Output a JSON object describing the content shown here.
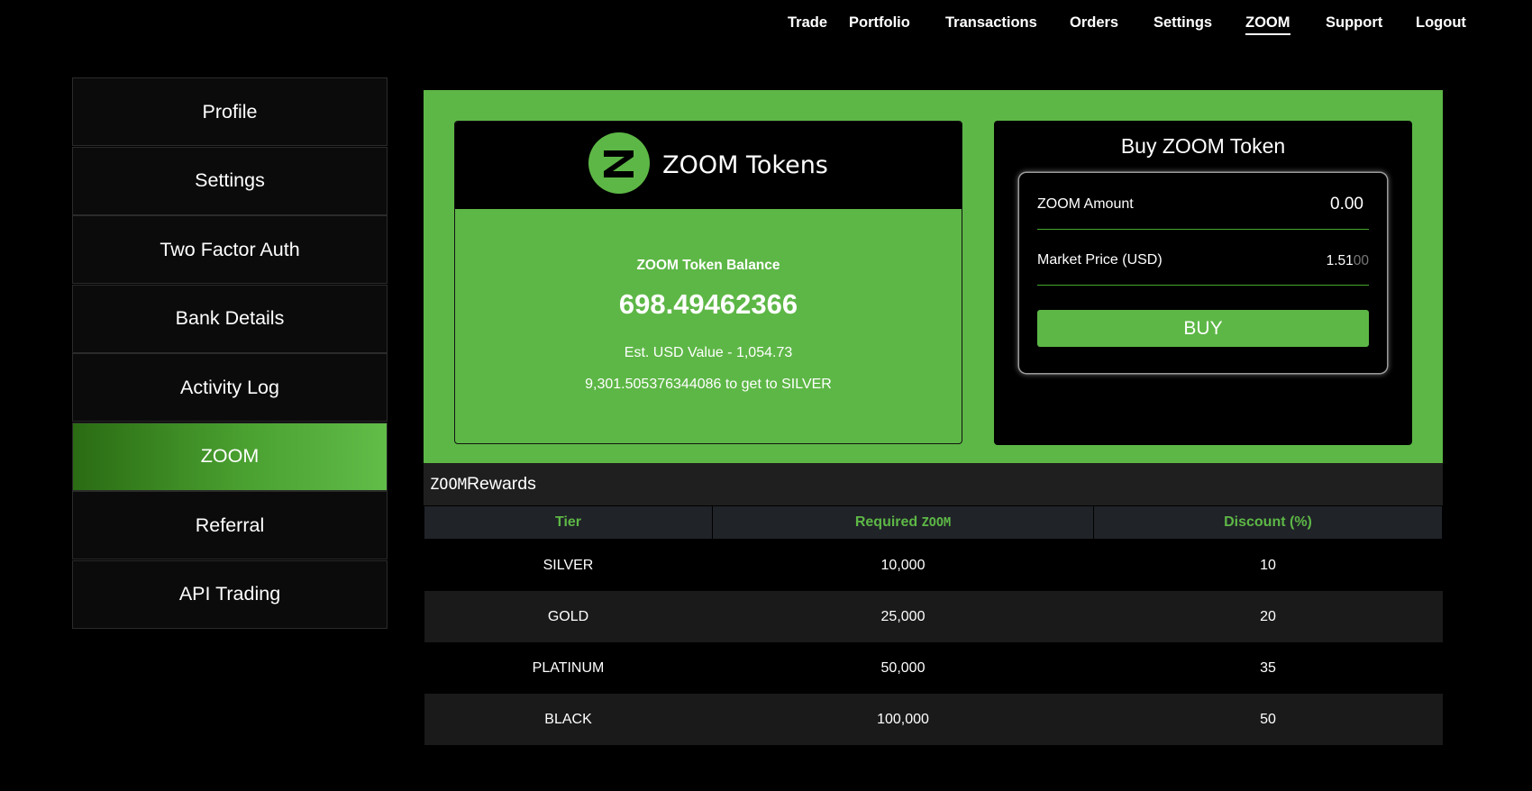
{
  "nav": {
    "items": [
      {
        "label": "Trade"
      },
      {
        "label": "Portfolio"
      },
      {
        "label": "Transactions"
      },
      {
        "label": "Orders"
      },
      {
        "label": "Settings"
      },
      {
        "label": "ZOOM",
        "active": true
      },
      {
        "label": "Support"
      },
      {
        "label": "Logout"
      }
    ]
  },
  "sidebar": {
    "items": [
      {
        "label": "Profile"
      },
      {
        "label": "Settings"
      },
      {
        "label": "Two Factor Auth"
      },
      {
        "label": "Bank Details"
      },
      {
        "label": "Activity Log"
      },
      {
        "label": "ZOOM",
        "active": true
      },
      {
        "label": "Referral"
      },
      {
        "label": "API Trading"
      }
    ]
  },
  "token_card": {
    "title": "ZOOM Tokens",
    "logo_icon": "zoom-logo-icon",
    "balance_label": "ZOOM Token Balance",
    "balance_value": "698.49462366",
    "usd_value": "Est. USD Value - 1,054.73",
    "next_tier": "9,301.505376344086 to get to SILVER"
  },
  "buy_card": {
    "title": "Buy ZOOM Token",
    "amount_label": "ZOOM Amount",
    "amount_value": "0.00",
    "price_label": "Market Price (USD)",
    "price_main": "1.51",
    "price_faded": "00",
    "buy_label": "BUY"
  },
  "rewards": {
    "title_prefix": "ZOOM",
    "title_suffix": " Rewards",
    "columns": {
      "tier": "Tier",
      "required_prefix": "Required ",
      "required_suffix": "ZOOM",
      "discount": "Discount (%)"
    },
    "rows": [
      {
        "tier": "SILVER",
        "required": "10,000",
        "discount": "10"
      },
      {
        "tier": "GOLD",
        "required": "25,000",
        "discount": "20"
      },
      {
        "tier": "PLATINUM",
        "required": "50,000",
        "discount": "35"
      },
      {
        "tier": "BLACK",
        "required": "100,000",
        "discount": "50"
      }
    ]
  },
  "colors": {
    "accent_green": "#5db746",
    "background": "#000000",
    "table_header": "#202328"
  }
}
